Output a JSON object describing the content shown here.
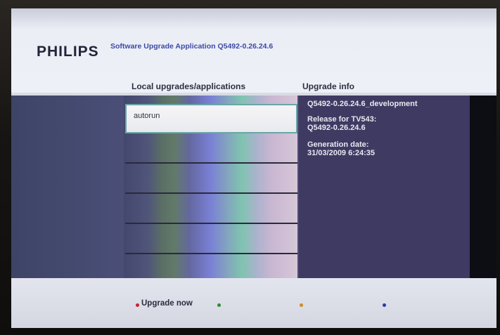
{
  "header": {
    "brand": "PHILIPS",
    "app_title": "Software Upgrade Application Q5492-0.26.24.6"
  },
  "columns": {
    "left_title": "Local upgrades/applications",
    "right_title": "Upgrade info"
  },
  "list": {
    "items": [
      {
        "label": "autorun",
        "selected": true
      },
      {
        "label": "",
        "selected": false
      },
      {
        "label": "",
        "selected": false
      },
      {
        "label": "",
        "selected": false
      },
      {
        "label": "",
        "selected": false
      },
      {
        "label": "",
        "selected": false
      }
    ]
  },
  "info": {
    "build": "Q5492-0.26.24.6_development",
    "release_label": "Release for TV543:",
    "release_value": "Q5492-0.26.24.6",
    "generation_label": "Generation date:",
    "generation_value": "31/03/2009 6:24:35"
  },
  "footer": {
    "red_label": "Upgrade now",
    "colors": {
      "red": "#c8202e",
      "green": "#2e8a3a",
      "yellow": "#d08a20",
      "blue": "#2a3aa0"
    }
  }
}
